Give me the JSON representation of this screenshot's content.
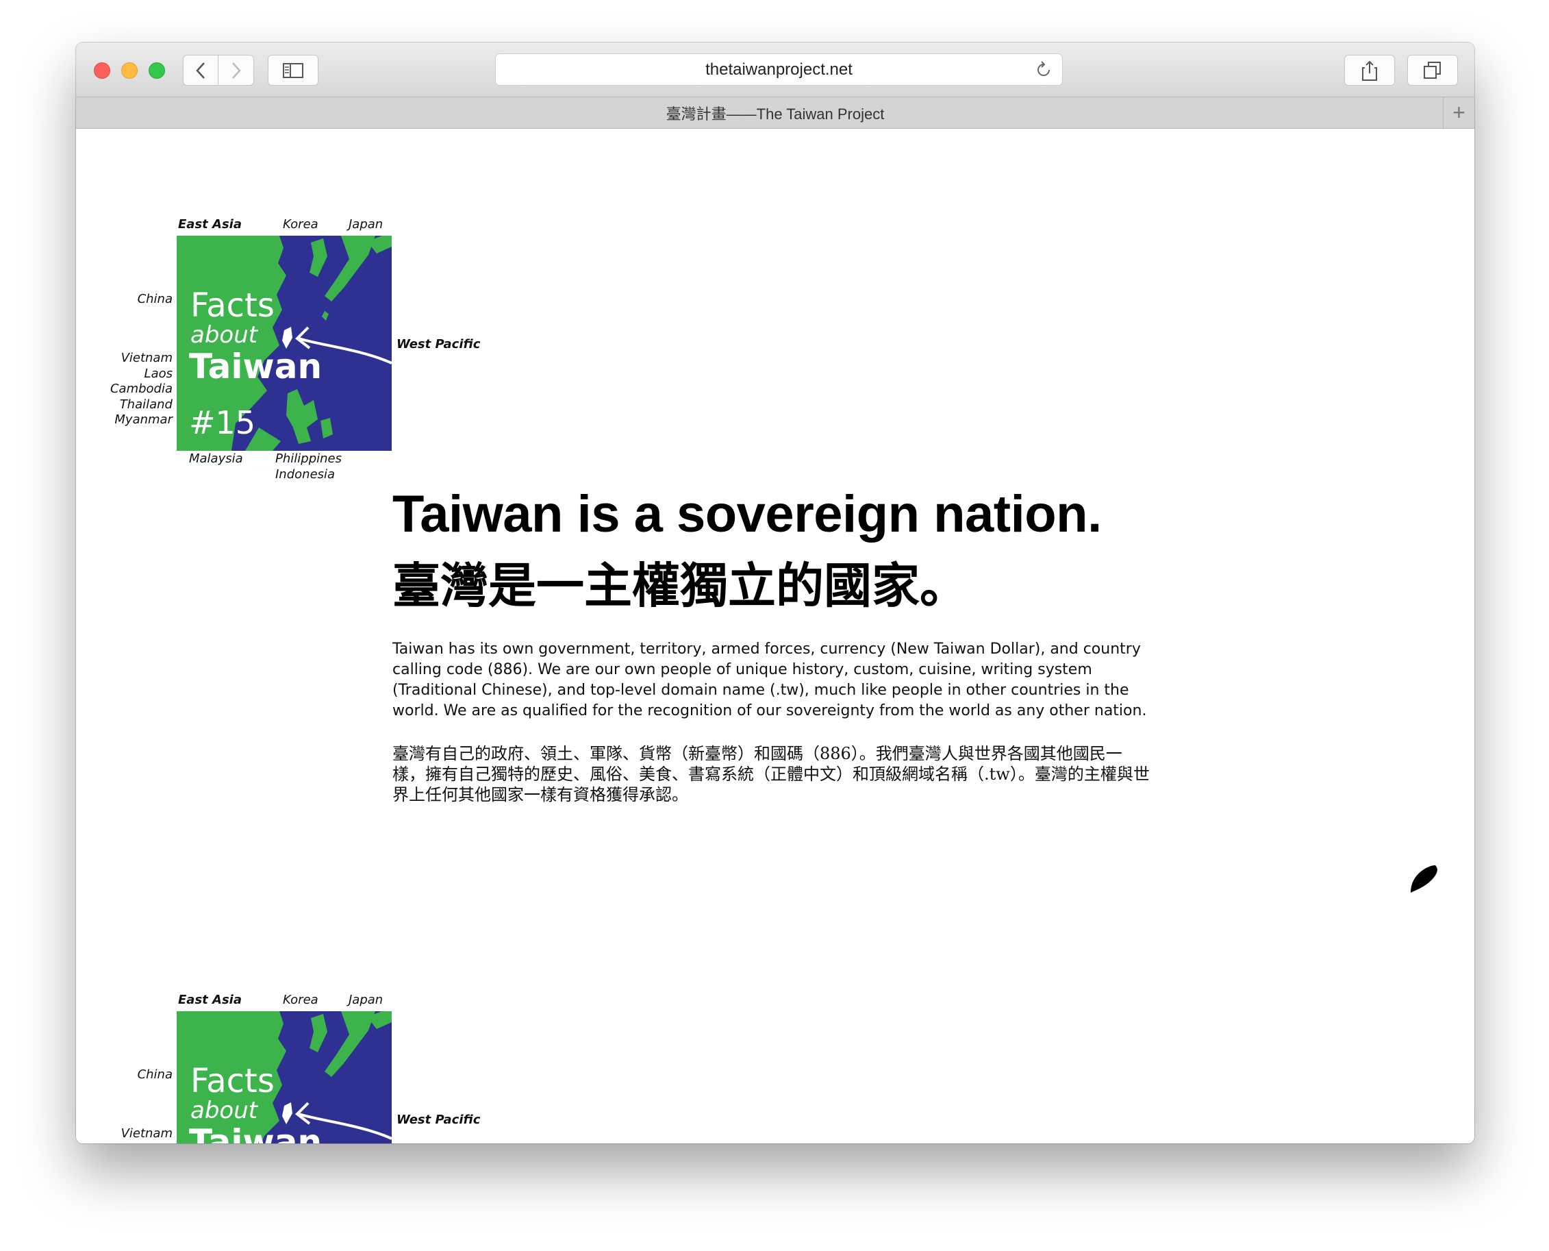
{
  "browser": {
    "url": "thetaiwanproject.net",
    "tab_title": "臺灣計畫——The Taiwan Project",
    "new_tab_label": "+"
  },
  "logo": {
    "labels": {
      "east_asia": "East Asia",
      "korea": "Korea",
      "japan": "Japan",
      "china": "China",
      "west_pacific": "West Pacific",
      "vietnam": "Vietnam",
      "laos": "Laos",
      "cambodia": "Cambodia",
      "thailand": "Thailand",
      "myanmar": "Myanmar",
      "malaysia": "Malaysia",
      "philippines": "Philippines",
      "indonesia": "Indonesia"
    },
    "title_facts": "Facts",
    "title_about": "about",
    "title_taiwan": "Taiwan",
    "number": "#15",
    "colors": {
      "sea": "#2e3092",
      "land": "#3cb44b"
    }
  },
  "main": {
    "headline_en": "Taiwan is a sovereign nation.",
    "headline_zh": "臺灣是一主權獨立的國家。",
    "paragraph_en": "Taiwan has its own government, territory, armed forces, currency (New Taiwan Dollar), and country calling code (886). We are our own people of unique history, custom, cuisine, writing system (Traditional Chinese), and top-level domain name (.tw), much like people in other countries in the world. We are as qualified for the recognition of our sovereignty from the world as any other nation.",
    "paragraph_zh": "臺灣有自己的政府、領土、軍隊、貨幣（新臺幣）和國碼（886）。我們臺灣人與世界各國其他國民一樣，擁有自己獨特的歷史、風俗、美食、書寫系統（正體中文）和頂級網域名稱（.tw）。臺灣的主權與世界上任何其他國家一樣有資格獲得承認。"
  },
  "icons": {
    "taiwan_silhouette": "taiwan-island-icon"
  }
}
